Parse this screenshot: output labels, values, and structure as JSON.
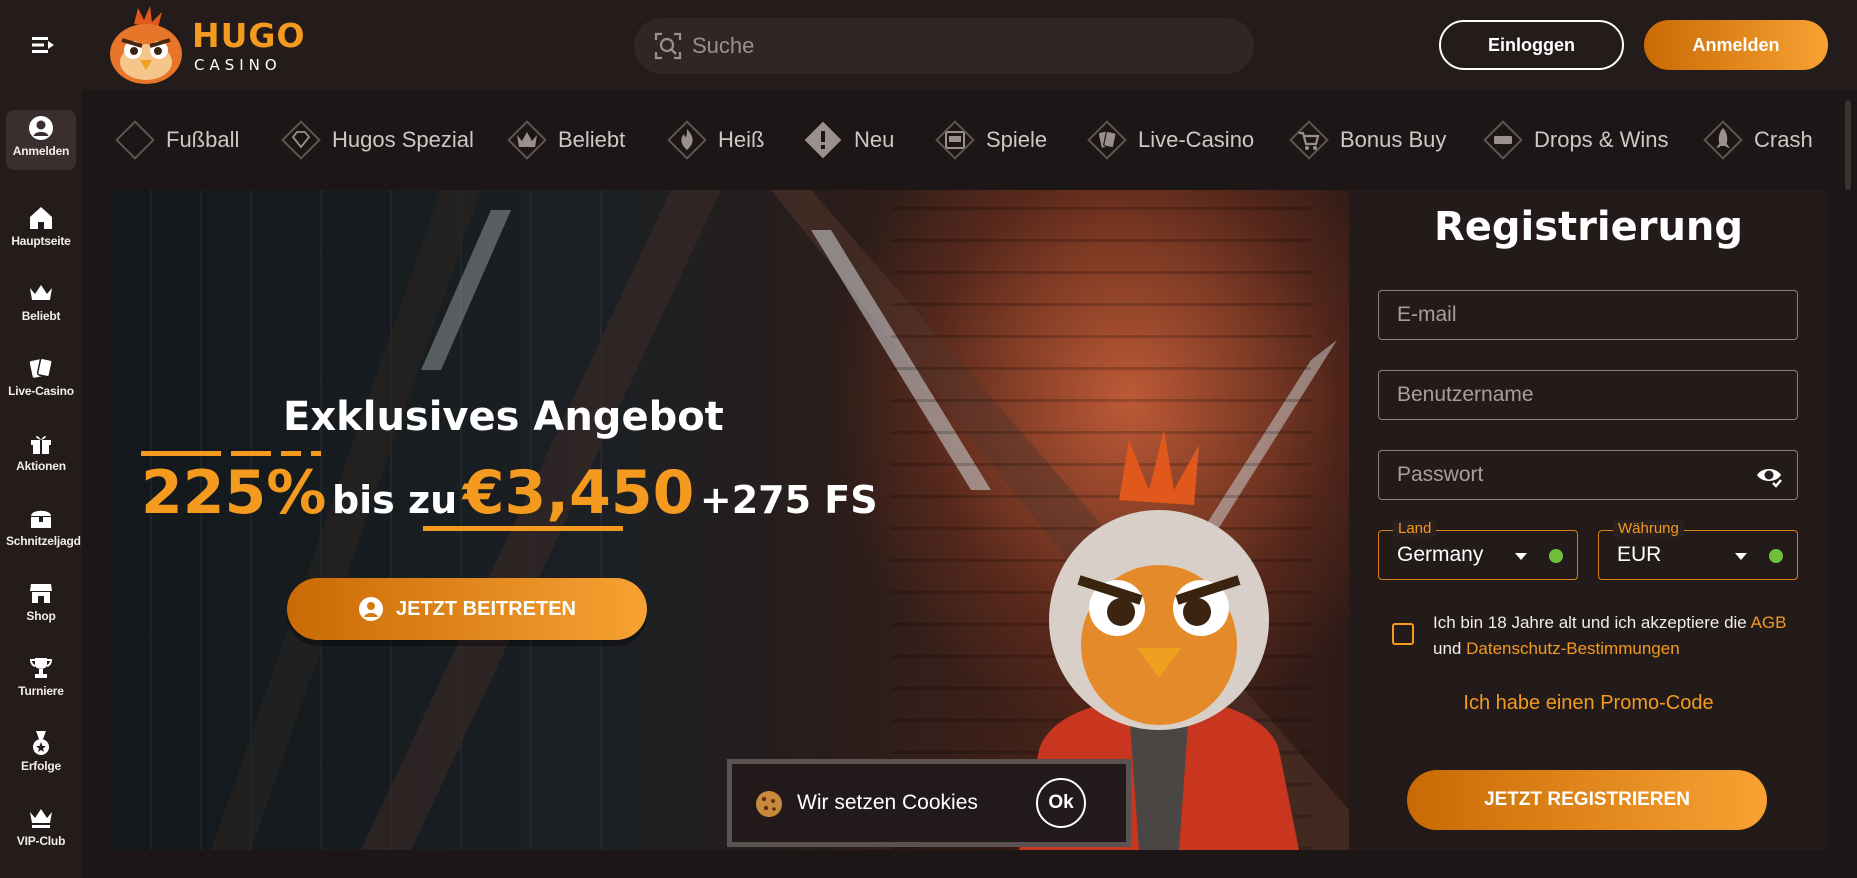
{
  "header": {
    "logo_word": "HUGO",
    "logo_sub": "CASINO",
    "search_placeholder": "Suche",
    "login_label": "Einloggen",
    "register_label": "Anmelden"
  },
  "sidebar": {
    "items": [
      {
        "label": "Anmelden",
        "icon": "user-circle-icon",
        "active": true
      },
      {
        "label": "Hauptseite",
        "icon": "home-icon"
      },
      {
        "label": "Beliebt",
        "icon": "crown-icon"
      },
      {
        "label": "Live-Casino",
        "icon": "cards-icon"
      },
      {
        "label": "Aktionen",
        "icon": "gift-icon"
      },
      {
        "label": "Schnitzeljagd",
        "icon": "treasure-chest-icon"
      },
      {
        "label": "Shop",
        "icon": "shop-icon"
      },
      {
        "label": "Turniere",
        "icon": "trophy-icon"
      },
      {
        "label": "Erfolge",
        "icon": "medal-icon"
      },
      {
        "label": "VIP-Club",
        "icon": "vip-crown-icon"
      }
    ]
  },
  "categories": [
    {
      "label": "Fußball",
      "icon": "football-icon"
    },
    {
      "label": "Hugos Spezial",
      "icon": "diamond-icon"
    },
    {
      "label": "Beliebt",
      "icon": "crown-icon"
    },
    {
      "label": "Heiß",
      "icon": "fire-icon"
    },
    {
      "label": "Neu",
      "icon": "exclamation-icon"
    },
    {
      "label": "Spiele",
      "icon": "slot-machine-icon"
    },
    {
      "label": "Live-Casino",
      "icon": "cards-icon"
    },
    {
      "label": "Bonus Buy",
      "icon": "cart-icon"
    },
    {
      "label": "Drops & Wins",
      "icon": "drops-wins-icon"
    },
    {
      "label": "Crash",
      "icon": "rocket-icon"
    }
  ],
  "hero": {
    "title": "Exklusives Angebot",
    "percent": "225%",
    "up_to": "bis zu",
    "amount": "€3,450",
    "spins": "+275 FS",
    "cta_label": "JETZT BEITRETEN"
  },
  "registration": {
    "title": "Registrierung",
    "email_placeholder": "E-mail",
    "username_placeholder": "Benutzername",
    "password_placeholder": "Passwort",
    "country_label": "Land",
    "country_value": "Germany",
    "currency_label": "Währung",
    "currency_value": "EUR",
    "terms_text": "Ich bin 18 Jahre alt und ich akzeptiere die",
    "terms_link": "AGB",
    "terms_and": "und",
    "privacy_link": "Datenschutz-Bestimmungen",
    "promo_label": "Ich habe einen Promo-Code",
    "submit_label": "JETZT REGISTRIEREN"
  },
  "cookie": {
    "text": "Wir setzen Cookies",
    "ok_label": "Ok"
  },
  "colors": {
    "accent": "#f39a1f",
    "background": "#1d1616",
    "panel": "#241b1b",
    "status_ok": "#6fbf3b"
  }
}
